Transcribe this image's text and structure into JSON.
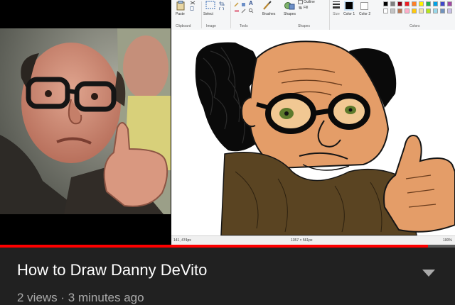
{
  "video": {
    "title": "How to Draw Danny DeVito",
    "meta": "2 views · 3 minutes ago",
    "progress": 0.94
  },
  "paint": {
    "labels": {
      "paste": "Paste",
      "select": "Select",
      "brushes": "Brushes",
      "shapes": "Shapes",
      "size": "Size",
      "color1": "Color 1",
      "color2": "Color 2",
      "outline": "Outline",
      "fill": "Fill"
    },
    "groups": {
      "clipboard": "Clipboard",
      "image": "Image",
      "tools": "Tools",
      "shapes": "Shapes",
      "colors": "Colors"
    },
    "status": {
      "position": "141, 474px",
      "size": "1357 × 561px",
      "zoom": "100%"
    },
    "palette": [
      "#000000",
      "#7f7f7f",
      "#880015",
      "#ed1c24",
      "#ff7f27",
      "#fff200",
      "#22b14c",
      "#00a2e8",
      "#3f48cc",
      "#a349a4",
      "#ffffff",
      "#c3c3c3",
      "#b97a57",
      "#ffaec9",
      "#ffc90e",
      "#efe4b0",
      "#b5e61d",
      "#99d9ea",
      "#7092be",
      "#c8bfe7"
    ]
  },
  "colors": {
    "accent": "#ff0000",
    "background": "#212121"
  },
  "icons": {
    "expand": "chevron-down-icon"
  }
}
